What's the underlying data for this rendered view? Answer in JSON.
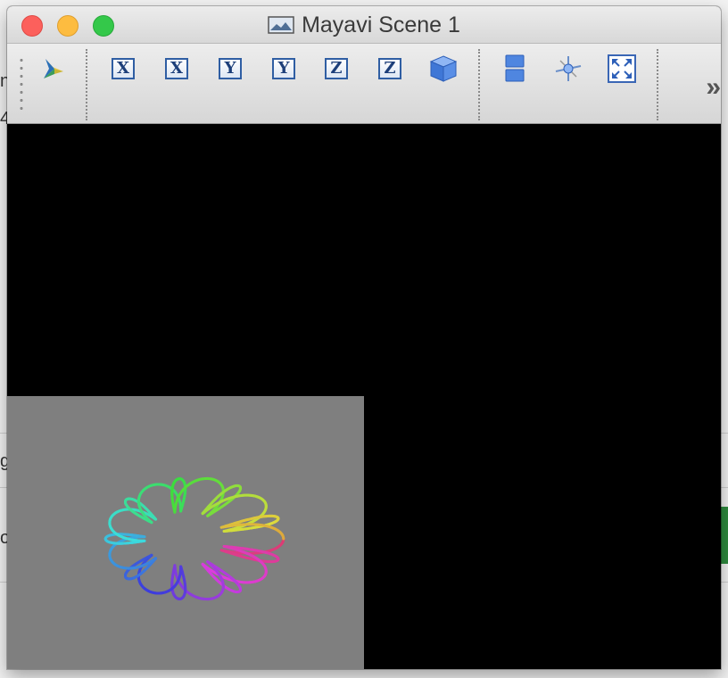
{
  "window": {
    "title": "Mayavi Scene 1"
  },
  "background": {
    "fragments": [
      "n",
      "4",
      "g",
      "o"
    ]
  },
  "toolbar": {
    "buttons": [
      {
        "name": "mayavi-engine",
        "icon": "tripod-icon"
      },
      {
        "name": "view-x-plus",
        "label": "X"
      },
      {
        "name": "view-x-minus",
        "label": "X"
      },
      {
        "name": "view-y-plus",
        "label": "Y"
      },
      {
        "name": "view-y-minus",
        "label": "Y"
      },
      {
        "name": "view-z-plus",
        "label": "Z"
      },
      {
        "name": "view-z-minus",
        "label": "Z"
      },
      {
        "name": "isometric-view",
        "icon": "cube-icon"
      },
      {
        "name": "parallel-projection",
        "icon": "stack-icon"
      },
      {
        "name": "toggle-axes",
        "icon": "axes-icon"
      },
      {
        "name": "full-screen",
        "icon": "fullscreen-icon"
      }
    ],
    "overflow_label": "»"
  },
  "scene": {
    "background_color": "#000000",
    "subview_color": "#7f7f7f"
  }
}
